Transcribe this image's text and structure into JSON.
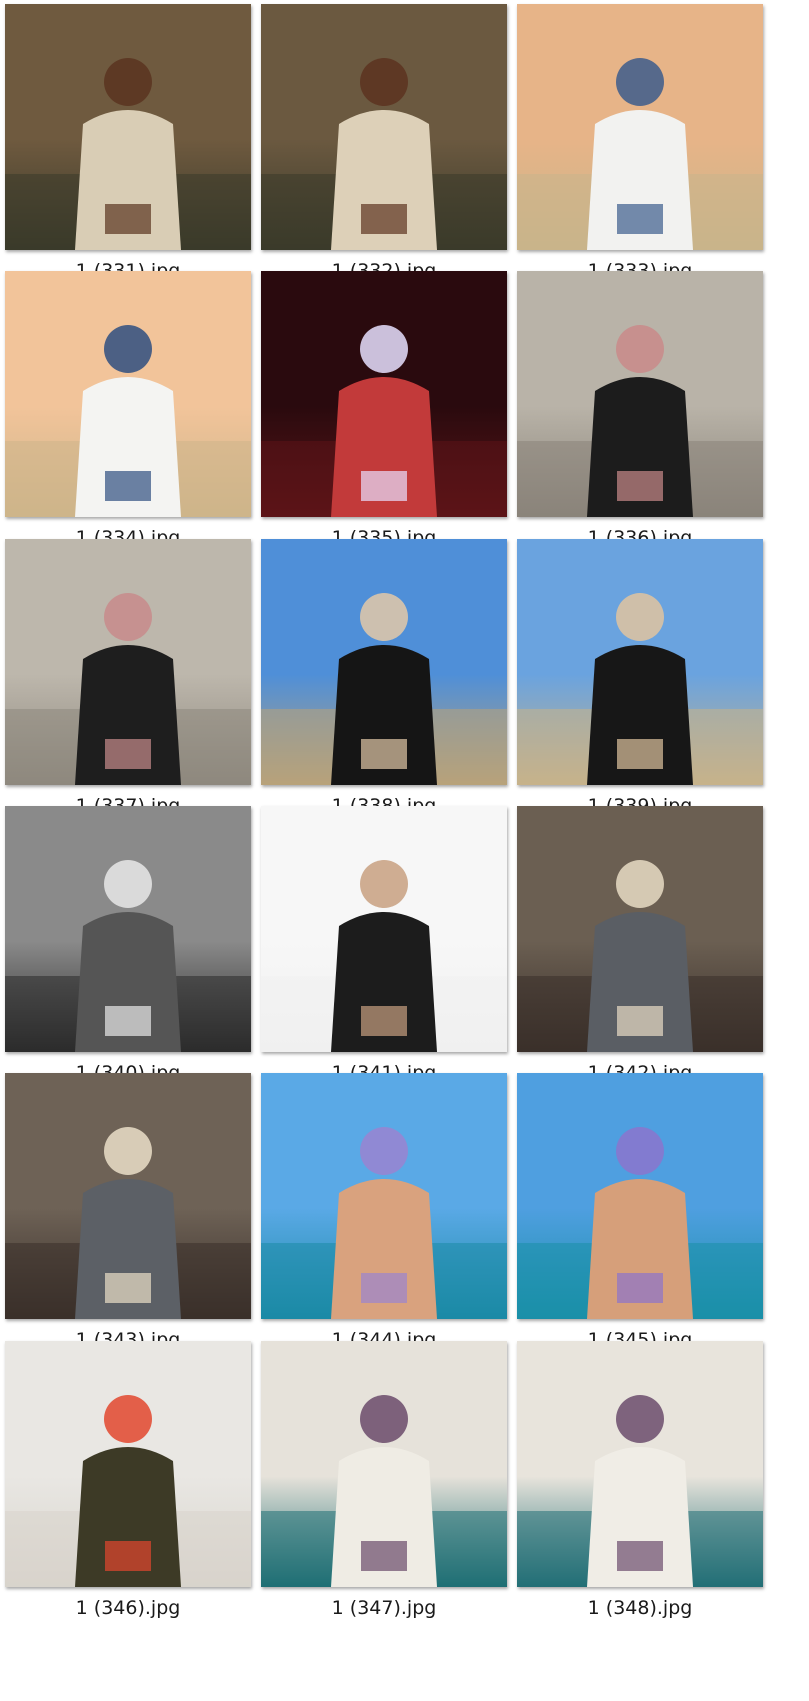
{
  "files": [
    {
      "name": "1 (331).jpg",
      "icon": "photo-thumbnail-icon",
      "palette": {
        "bg": "#6f5a3f",
        "ground": "#3a3a2a",
        "figure": "#d9cdb5",
        "accent": "#5a3420"
      }
    },
    {
      "name": "1 (332).jpg",
      "icon": "photo-thumbnail-icon",
      "palette": {
        "bg": "#6b5940",
        "ground": "#3b3a2a",
        "figure": "#ddd0b8",
        "accent": "#5c3320"
      }
    },
    {
      "name": "1 (333).jpg",
      "icon": "photo-thumbnail-icon",
      "palette": {
        "bg": "#e7b488",
        "ground": "#c9b48a",
        "figure": "#f2f2f0",
        "accent": "#3c5c8c"
      }
    },
    {
      "name": "1 (334).jpg",
      "icon": "photo-thumbnail-icon",
      "palette": {
        "bg": "#f2c49a",
        "ground": "#cdb58a",
        "figure": "#f4f4f2",
        "accent": "#2f4f80"
      }
    },
    {
      "name": "1 (335).jpg",
      "icon": "photo-thumbnail-icon",
      "palette": {
        "bg": "#2a0a0e",
        "ground": "#5c1418",
        "figure": "#c23a3a",
        "accent": "#e8e0ff"
      }
    },
    {
      "name": "1 (336).jpg",
      "icon": "photo-thumbnail-icon",
      "palette": {
        "bg": "#b9b3a8",
        "ground": "#8a847a",
        "figure": "#1c1c1c",
        "accent": "#c98a8a"
      }
    },
    {
      "name": "1 (337).jpg",
      "icon": "photo-thumbnail-icon",
      "palette": {
        "bg": "#bdb7ac",
        "ground": "#8e887e",
        "figure": "#1e1e1e",
        "accent": "#c88b8b"
      }
    },
    {
      "name": "1 (338).jpg",
      "icon": "photo-thumbnail-icon",
      "palette": {
        "bg": "#4f8fd8",
        "ground": "#b8a27a",
        "figure": "#151515",
        "accent": "#e3c9a8"
      }
    },
    {
      "name": "1 (339).jpg",
      "icon": "photo-thumbnail-icon",
      "palette": {
        "bg": "#6aa3df",
        "ground": "#c7b28a",
        "figure": "#171717",
        "accent": "#e0c4a0"
      }
    },
    {
      "name": "1 (340).jpg",
      "icon": "photo-thumbnail-icon",
      "palette": {
        "bg": "#8a8a8a",
        "ground": "#2c2c2c",
        "figure": "#555555",
        "accent": "#e8e8e8"
      }
    },
    {
      "name": "1 (341).jpg",
      "icon": "photo-thumbnail-icon",
      "palette": {
        "bg": "#f7f7f7",
        "ground": "#f0f0f0",
        "figure": "#1c1c1c",
        "accent": "#c8a080"
      }
    },
    {
      "name": "1 (342).jpg",
      "icon": "photo-thumbnail-icon",
      "palette": {
        "bg": "#6b5f52",
        "ground": "#3a302a",
        "figure": "#5a5e64",
        "accent": "#e8dcc4"
      }
    },
    {
      "name": "1 (343).jpg",
      "icon": "photo-thumbnail-icon",
      "palette": {
        "bg": "#6e6256",
        "ground": "#3a302a",
        "figure": "#5c6066",
        "accent": "#ebdfc8"
      }
    },
    {
      "name": "1 (344).jpg",
      "icon": "photo-thumbnail-icon",
      "palette": {
        "bg": "#5aa9e6",
        "ground": "#1b8aa6",
        "figure": "#d9a27e",
        "accent": "#9a84d0"
      }
    },
    {
      "name": "1 (345).jpg",
      "icon": "photo-thumbnail-icon",
      "palette": {
        "bg": "#4f9fe0",
        "ground": "#1a8fa8",
        "figure": "#d69f7a",
        "accent": "#8b74cc"
      }
    },
    {
      "name": "1 (346).jpg",
      "icon": "photo-thumbnail-icon",
      "palette": {
        "bg": "#e9e7e3",
        "ground": "#d8d4cc",
        "figure": "#3d3a26",
        "accent": "#e2462e"
      }
    },
    {
      "name": "1 (347).jpg",
      "icon": "photo-thumbnail-icon",
      "palette": {
        "bg": "#e6e2da",
        "ground": "#1f6f74",
        "figure": "#efece4",
        "accent": "#6a4a6a"
      }
    },
    {
      "name": "1 (348).jpg",
      "icon": "photo-thumbnail-icon",
      "palette": {
        "bg": "#e8e4dc",
        "ground": "#236f76",
        "figure": "#f0ede6",
        "accent": "#6b4c6c"
      }
    }
  ]
}
